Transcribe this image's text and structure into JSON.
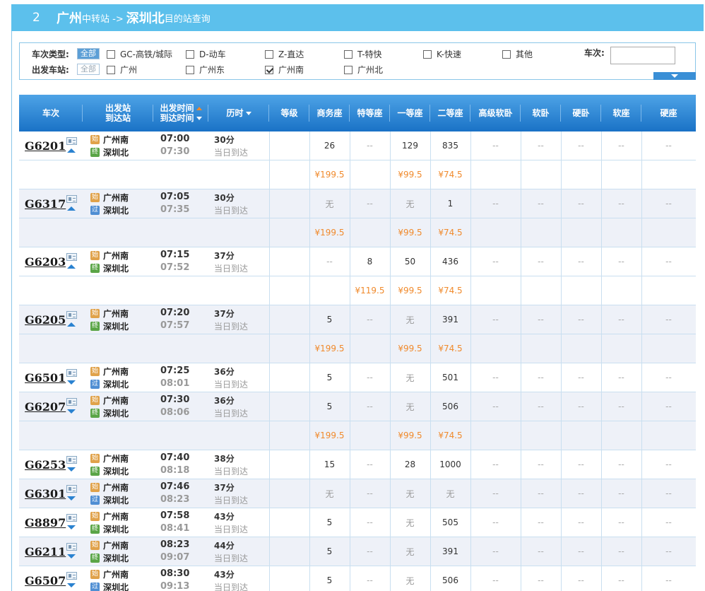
{
  "title": {
    "index": "2",
    "from": "广州",
    "from_suffix": "中转站 ->",
    "to": "深圳北",
    "to_suffix": "目的站查询"
  },
  "filters": {
    "type_label": "车次类型:",
    "station_label": "出发车站:",
    "all_label": "全部",
    "train_no_label": "车次:",
    "train_no_value": "",
    "types": [
      {
        "label": "GC-高铁/城际",
        "checked": false
      },
      {
        "label": "D-动车",
        "checked": false
      },
      {
        "label": "Z-直达",
        "checked": false
      },
      {
        "label": "T-特快",
        "checked": false
      },
      {
        "label": "K-快速",
        "checked": false
      },
      {
        "label": "其他",
        "checked": false
      }
    ],
    "stations": [
      {
        "label": "广州",
        "checked": false
      },
      {
        "label": "广州东",
        "checked": false
      },
      {
        "label": "广州南",
        "checked": true
      },
      {
        "label": "广州北",
        "checked": false
      }
    ]
  },
  "columns": {
    "train": "车次",
    "station_top": "出发站",
    "station_bottom": "到达站",
    "time_top": "出发时间",
    "time_bottom": "到达时间",
    "duration": "历时",
    "level": "等级",
    "seats": [
      "商务座",
      "特等座",
      "一等座",
      "二等座",
      "高级软卧",
      "软卧",
      "硬卧",
      "软座",
      "硬座"
    ]
  },
  "badges": {
    "start": "始",
    "end": "终",
    "pass": "过"
  },
  "same_day": "当日到达",
  "rows": [
    {
      "kind": "train",
      "no": "G6201",
      "dir": "up",
      "from": "广州南",
      "to": "深圳北",
      "end_type": "end",
      "dep": "07:00",
      "arr": "07:30",
      "dur": "30分",
      "seats": [
        "26",
        "--",
        "129",
        "835",
        "--",
        "--",
        "--",
        "--",
        "--"
      ]
    },
    {
      "kind": "price",
      "prices": [
        "¥199.5",
        "",
        "¥99.5",
        "¥74.5",
        "",
        "",
        "",
        "",
        ""
      ]
    },
    {
      "kind": "train",
      "no": "G6317",
      "dir": "up",
      "from": "广州南",
      "to": "深圳北",
      "end_type": "pass",
      "dep": "07:05",
      "arr": "07:35",
      "dur": "30分",
      "seats": [
        "无",
        "--",
        "无",
        "1",
        "--",
        "--",
        "--",
        "--",
        "--"
      ]
    },
    {
      "kind": "price",
      "prices": [
        "¥199.5",
        "",
        "¥99.5",
        "¥74.5",
        "",
        "",
        "",
        "",
        ""
      ]
    },
    {
      "kind": "train",
      "no": "G6203",
      "dir": "up",
      "from": "广州南",
      "to": "深圳北",
      "end_type": "end",
      "dep": "07:15",
      "arr": "07:52",
      "dur": "37分",
      "seats": [
        "--",
        "8",
        "50",
        "436",
        "--",
        "--",
        "--",
        "--",
        "--"
      ]
    },
    {
      "kind": "price",
      "prices": [
        "",
        "¥119.5",
        "¥99.5",
        "¥74.5",
        "",
        "",
        "",
        "",
        ""
      ]
    },
    {
      "kind": "train",
      "no": "G6205",
      "dir": "up",
      "from": "广州南",
      "to": "深圳北",
      "end_type": "end",
      "dep": "07:20",
      "arr": "07:57",
      "dur": "37分",
      "seats": [
        "5",
        "--",
        "无",
        "391",
        "--",
        "--",
        "--",
        "--",
        "--"
      ]
    },
    {
      "kind": "price",
      "prices": [
        "¥199.5",
        "",
        "¥99.5",
        "¥74.5",
        "",
        "",
        "",
        "",
        ""
      ]
    },
    {
      "kind": "train",
      "no": "G6501",
      "dir": "down",
      "from": "广州南",
      "to": "深圳北",
      "end_type": "pass",
      "dep": "07:25",
      "arr": "08:01",
      "dur": "36分",
      "seats": [
        "5",
        "--",
        "无",
        "501",
        "--",
        "--",
        "--",
        "--",
        "--"
      ]
    },
    {
      "kind": "train",
      "no": "G6207",
      "dir": "down",
      "from": "广州南",
      "to": "深圳北",
      "end_type": "end",
      "dep": "07:30",
      "arr": "08:06",
      "dur": "36分",
      "seats": [
        "5",
        "--",
        "无",
        "506",
        "--",
        "--",
        "--",
        "--",
        "--"
      ]
    },
    {
      "kind": "price",
      "prices": [
        "¥199.5",
        "",
        "¥99.5",
        "¥74.5",
        "",
        "",
        "",
        "",
        ""
      ]
    },
    {
      "kind": "train",
      "no": "G6253",
      "dir": "down",
      "from": "广州南",
      "to": "深圳北",
      "end_type": "end",
      "dep": "07:40",
      "arr": "08:18",
      "dur": "38分",
      "seats": [
        "15",
        "--",
        "28",
        "1000",
        "--",
        "--",
        "--",
        "--",
        "--"
      ]
    },
    {
      "kind": "train",
      "no": "G6301",
      "dir": "down",
      "from": "广州南",
      "to": "深圳北",
      "end_type": "pass",
      "dep": "07:46",
      "arr": "08:23",
      "dur": "37分",
      "seats": [
        "无",
        "--",
        "无",
        "无",
        "--",
        "--",
        "--",
        "--",
        "--"
      ]
    },
    {
      "kind": "train",
      "no": "G8897",
      "dir": "down",
      "from": "广州南",
      "to": "深圳北",
      "end_type": "end",
      "dep": "07:58",
      "arr": "08:41",
      "dur": "43分",
      "seats": [
        "5",
        "--",
        "无",
        "505",
        "--",
        "--",
        "--",
        "--",
        "--"
      ]
    },
    {
      "kind": "train",
      "no": "G6211",
      "dir": "down",
      "from": "广州南",
      "to": "深圳北",
      "end_type": "end",
      "dep": "08:23",
      "arr": "09:07",
      "dur": "44分",
      "seats": [
        "5",
        "--",
        "无",
        "391",
        "--",
        "--",
        "--",
        "--",
        "--"
      ]
    },
    {
      "kind": "train",
      "no": "G6507",
      "dir": "down",
      "from": "广州南",
      "to": "深圳北",
      "end_type": "pass",
      "dep": "08:30",
      "arr": "09:13",
      "dur": "43分",
      "seats": [
        "5",
        "--",
        "无",
        "506",
        "--",
        "--",
        "--",
        "--",
        "--"
      ]
    }
  ]
}
